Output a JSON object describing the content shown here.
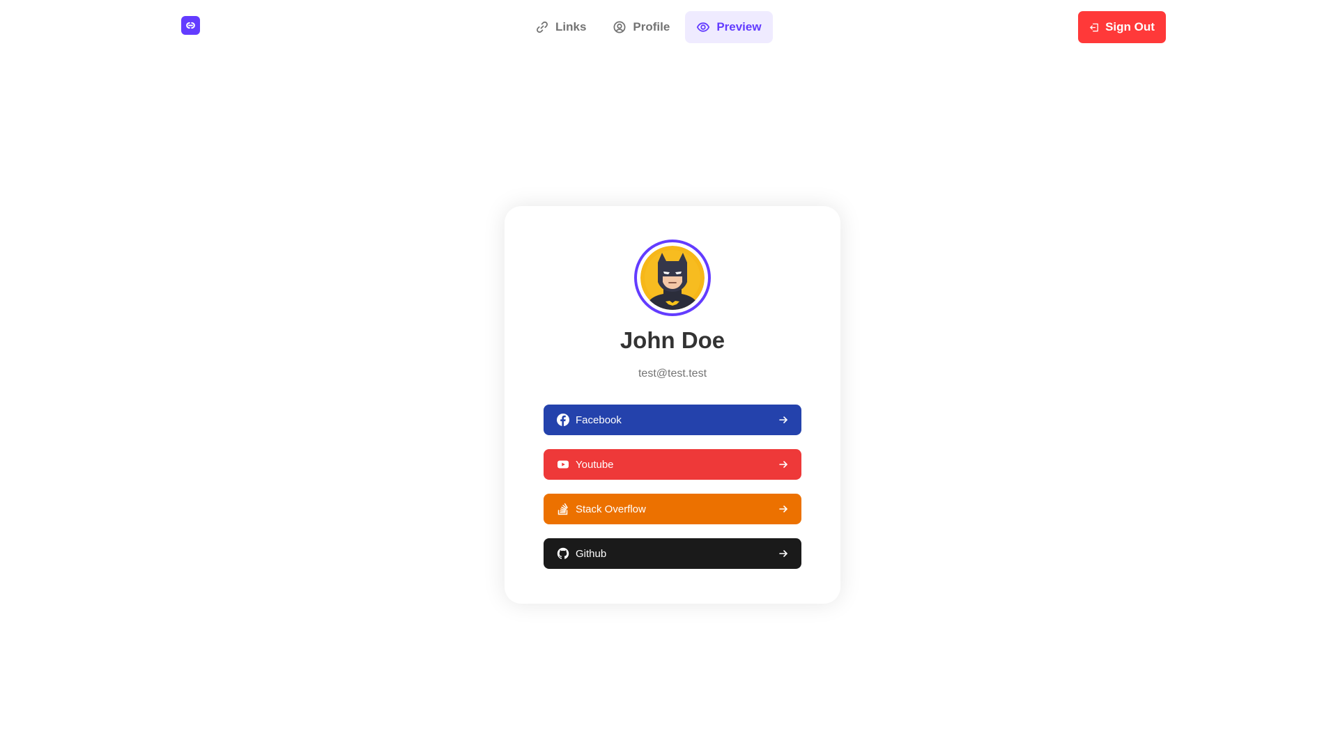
{
  "app": {
    "logo_icon": "link-logo-icon",
    "brand_color": "#633cff"
  },
  "nav": {
    "tabs": [
      {
        "label": "Links",
        "icon": "link-icon",
        "active": false
      },
      {
        "label": "Profile",
        "icon": "user-circle-icon",
        "active": false
      },
      {
        "label": "Preview",
        "icon": "eye-icon",
        "active": true
      }
    ]
  },
  "header": {
    "signout_label": "Sign Out",
    "signout_icon": "sign-out-icon",
    "signout_color": "#ff3939"
  },
  "profile": {
    "avatar": "batman-avatar",
    "name": "John Doe",
    "email": "test@test.test"
  },
  "links": [
    {
      "label": "Facebook",
      "icon": "facebook-icon",
      "color": "#2442ac"
    },
    {
      "label": "Youtube",
      "icon": "youtube-icon",
      "color": "#ee3939"
    },
    {
      "label": "Stack Overflow",
      "icon": "stackoverflow-icon",
      "color": "#ec7100"
    },
    {
      "label": "Github",
      "icon": "github-icon",
      "color": "#1a1a1a"
    }
  ]
}
